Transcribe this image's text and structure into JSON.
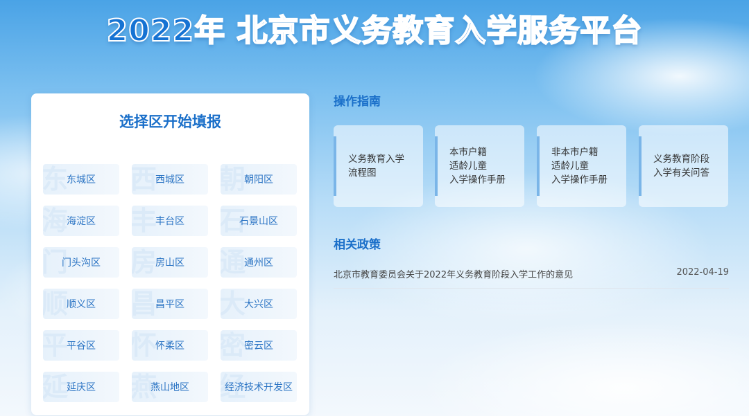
{
  "header": {
    "title": "2022年 北京市义务教育入学服务平台"
  },
  "district_panel": {
    "title": "选择区开始填报",
    "districts": [
      {
        "label": "东城区",
        "watermark": "东"
      },
      {
        "label": "西城区",
        "watermark": "西"
      },
      {
        "label": "朝阳区",
        "watermark": "朝"
      },
      {
        "label": "海淀区",
        "watermark": "海"
      },
      {
        "label": "丰台区",
        "watermark": "丰"
      },
      {
        "label": "石景山区",
        "watermark": "石"
      },
      {
        "label": "门头沟区",
        "watermark": "门"
      },
      {
        "label": "房山区",
        "watermark": "房"
      },
      {
        "label": "通州区",
        "watermark": "通"
      },
      {
        "label": "顺义区",
        "watermark": "顺"
      },
      {
        "label": "昌平区",
        "watermark": "昌"
      },
      {
        "label": "大兴区",
        "watermark": "大"
      },
      {
        "label": "平谷区",
        "watermark": "平"
      },
      {
        "label": "怀柔区",
        "watermark": "怀"
      },
      {
        "label": "密云区",
        "watermark": "密"
      },
      {
        "label": "延庆区",
        "watermark": "延"
      },
      {
        "label": "燕山地区",
        "watermark": "燕"
      },
      {
        "label": "经济技术开发区",
        "watermark": "经"
      }
    ]
  },
  "guide": {
    "title": "操作指南",
    "cards": [
      {
        "lines": [
          "义务教育入学",
          "流程图"
        ]
      },
      {
        "lines": [
          "本市户籍",
          "适龄儿童",
          "入学操作手册"
        ]
      },
      {
        "lines": [
          "非本市户籍",
          "适龄儿童",
          "入学操作手册"
        ]
      },
      {
        "lines": [
          "义务教育阶段",
          "入学有关问答"
        ]
      }
    ]
  },
  "policy": {
    "title": "相关政策",
    "items": [
      {
        "title": "北京市教育委员会关于2022年义务教育阶段入学工作的意见",
        "date": "2022-04-19"
      }
    ]
  },
  "colors": {
    "accent": "#1a6fc9",
    "title_blue": "#1573d3",
    "card_bar": "#7ab5e8"
  }
}
